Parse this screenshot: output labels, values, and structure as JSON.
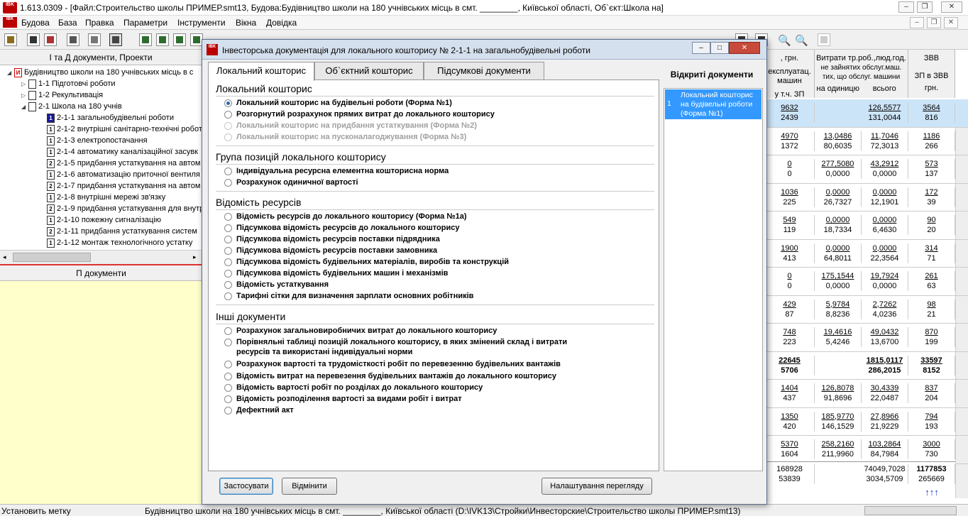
{
  "window": {
    "title": "1.613.0309 - [Файл:Строительство школы ПРИМЕР.smt13, Будова:Будівництво школи на 180 учнівських місць в смт. ________, Київської області, Об`єкт:Школа на]",
    "logo": "IBK"
  },
  "menu": [
    "Будова",
    "База",
    "Правка",
    "Параметри",
    "Інструменти",
    "Вікна",
    "Довідка"
  ],
  "left_panel": {
    "header": "І та Д документи, Проекти",
    "tree": [
      {
        "label": "Будівництво школи на 180 учнівських місць в с",
        "icon": "И"
      },
      {
        "label": "1-1 Підготовчі роботи",
        "icon": ""
      },
      {
        "label": "1-2 Рекультивація",
        "icon": ""
      },
      {
        "label": "2-1 Школа на 180 учнів",
        "icon": ""
      },
      {
        "label": "2-1-1 загальнобудівельні роботи",
        "icon": "1"
      },
      {
        "label": "2-1-2 внутрішні санітарно-технічні роботи",
        "icon": "1"
      },
      {
        "label": "2-1-3 електропостачання",
        "icon": "1"
      },
      {
        "label": "2-1-4 автоматику каналізаційної засувк",
        "icon": "1"
      },
      {
        "label": "2-1-5 придбання устаткування на автом",
        "icon": "2"
      },
      {
        "label": "2-1-6 автоматизацію приточної вентиля",
        "icon": "1"
      },
      {
        "label": "2-1-7 придбання устаткування на автом",
        "icon": "2"
      },
      {
        "label": "2-1-8 внутрішні мережі зв'язку",
        "icon": "1"
      },
      {
        "label": "2-1-9 придбання устаткування для внутр",
        "icon": "2"
      },
      {
        "label": "2-1-10 пожежну сигналізацію",
        "icon": "1"
      },
      {
        "label": "2-1-11 придбання устаткування систем",
        "icon": "2"
      },
      {
        "label": "2-1-12 монтаж технологічного  устатку",
        "icon": "1"
      }
    ],
    "p_header": "П документи"
  },
  "grid": {
    "headers": [
      {
        "top": ", грн.",
        "bottom": "експлуатац. машин",
        "sub": "у т.ч. ЗП"
      },
      {
        "top": "Витрати тр.роб.,люд.год.",
        "mid": "не зайнятих обслуг.маш. тих, що обслуг. машини",
        "sub1": "на одиницю",
        "sub2": "всього"
      },
      {
        "top": "ЗВВ",
        "mid": "ЗП в ЗВВ",
        "sub": "грн."
      }
    ],
    "rows": [
      [
        "9632",
        "2439",
        "",
        "",
        "126,5577",
        "131,0044",
        "3564",
        "816"
      ],
      [
        "4970",
        "1372",
        "13,0486",
        "80,6035",
        "11,7046",
        "72,3013",
        "1186",
        "266"
      ],
      [
        "0",
        "0",
        "277,5080",
        "0,0000",
        "43,2912",
        "0,0000",
        "573",
        "137"
      ],
      [
        "1036",
        "225",
        "0,0000",
        "26,7327",
        "0,0000",
        "12,1901",
        "172",
        "39"
      ],
      [
        "549",
        "119",
        "0,0000",
        "18,7334",
        "0,0000",
        "6,4630",
        "90",
        "20"
      ],
      [
        "1900",
        "413",
        "0,0000",
        "64,8011",
        "0,0000",
        "22,3564",
        "314",
        "71"
      ],
      [
        "0",
        "0",
        "175,1544",
        "0,0000",
        "19,7924",
        "0,0000",
        "261",
        "63"
      ],
      [
        "429",
        "87",
        "5,9784",
        "8,8236",
        "2,7262",
        "4,0236",
        "98",
        "21"
      ],
      [
        "748",
        "223",
        "19,4616",
        "5,4246",
        "49,0432",
        "13,6700",
        "870",
        "199"
      ],
      [
        "22645",
        "5706",
        "",
        "",
        "1815,0117",
        "286,2015",
        "33597",
        "8152"
      ],
      [
        "1404",
        "437",
        "126,8078",
        "91,8696",
        "30,4339",
        "22,0487",
        "837",
        "204"
      ],
      [
        "1350",
        "420",
        "185,9770",
        "146,1529",
        "27,8966",
        "21,9229",
        "794",
        "193"
      ],
      [
        "5370",
        "1604",
        "258,2160",
        "211,9960",
        "103,2864",
        "84,7984",
        "3000",
        "730"
      ]
    ],
    "totals": [
      "168928",
      "53839",
      "",
      "",
      "74049,7028",
      "3034,5709",
      "1177853",
      "265669"
    ],
    "arrows": "↑↑↑"
  },
  "status": {
    "left": "Установить метку",
    "right": "Будівництво школи на 180 учнівських місць в смт. ________, Київської області (D:\\IVK13\\Стройки\\Инвесторские\\Строительство школы ПРИМЕР.smt13)"
  },
  "dialog": {
    "title": "Інвесторська документація для локального кошторису № 2-1-1 на загальнобудівельні роботи",
    "tabs": [
      "Локальний кошторис",
      "Об`єктний кошторис",
      "Підсумкові документи"
    ],
    "sections": [
      {
        "title": "Локальний кошторис",
        "options": [
          {
            "label": "Локальний кошторис на будівельні роботи (Форма №1)",
            "checked": true,
            "disabled": false
          },
          {
            "label": "Розгорнутий розрахунок прямих витрат до локального кошторису",
            "checked": false,
            "disabled": false
          },
          {
            "label": "Локальний кошторис на придбання устаткування (Форма №2)",
            "checked": false,
            "disabled": true
          },
          {
            "label": "Локальний кошторис на пусконалагоджування (Форма №3)",
            "checked": false,
            "disabled": true
          }
        ]
      },
      {
        "title": "Група позицій локального кошторису",
        "options": [
          {
            "label": "Індивідуальна ресурсна елементна кошторисна норма",
            "checked": false,
            "disabled": false
          },
          {
            "label": "Розрахунок одиничної вартості",
            "checked": false,
            "disabled": false
          }
        ]
      },
      {
        "title": "Відомість ресурсів",
        "options": [
          {
            "label": "Відомість ресурсів до локального кошторису (Форма №1а)",
            "checked": false,
            "disabled": false
          },
          {
            "label": "Підсумкова відомість ресурсів до локального кошторису",
            "checked": false,
            "disabled": false
          },
          {
            "label": "Підсумкова відомість ресурсів поставки підрядника",
            "checked": false,
            "disabled": false
          },
          {
            "label": "Підсумкова відомість ресурсів поставки замовника",
            "checked": false,
            "disabled": false
          },
          {
            "label": "Підсумкова відомість будівельних матеріалів, виробів та конструкцій",
            "checked": false,
            "disabled": false
          },
          {
            "label": "Підсумкова відомість будівельних машин і механізмів",
            "checked": false,
            "disabled": false
          },
          {
            "label": "Відомість устаткування",
            "checked": false,
            "disabled": false
          },
          {
            "label": "Тарифні сітки для визначення зарплати основних робітників",
            "checked": false,
            "disabled": false
          }
        ]
      },
      {
        "title": "Інші документи",
        "options": [
          {
            "label": "Розрахунок загальновиробничих витрат до локального кошторису",
            "checked": false,
            "disabled": false
          },
          {
            "label": "Порівняльні таблиці позицій локального кошторису, в яких змінений склад і витрати",
            "label2": "ресурсів та використані індивідуальні норми",
            "checked": false,
            "disabled": false
          },
          {
            "label": "Розрахунок вартості та трудомісткості робіт по перевезенню будівельних вантажів",
            "checked": false,
            "disabled": false
          },
          {
            "label": "Відомість витрат на перевезення будівельних вантажів до локального кошторису",
            "checked": false,
            "disabled": false
          },
          {
            "label": "Відомість вартості робіт по розділах до локального кошторису",
            "checked": false,
            "disabled": false
          },
          {
            "label": "Відомість розподілення вартості за видами робіт і витрат",
            "checked": false,
            "disabled": false
          },
          {
            "label": "Дефектний акт",
            "checked": false,
            "disabled": false
          }
        ]
      }
    ],
    "opened_header": "Відкриті документи",
    "opened_item": {
      "num": "1",
      "label": "Локальний кошторис на будівельні роботи (Форма №1)"
    },
    "buttons": {
      "apply": "Застосувати",
      "cancel": "Відмінити",
      "settings": "Налаштування перегляду"
    }
  }
}
